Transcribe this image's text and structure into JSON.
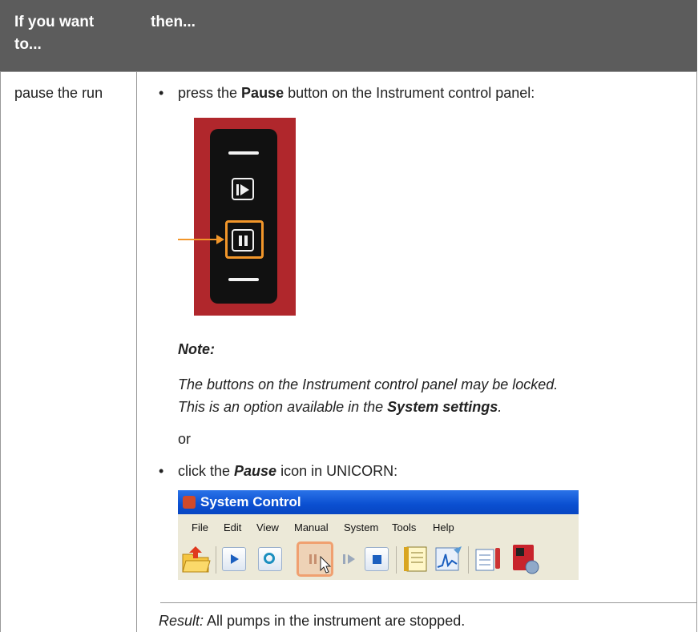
{
  "header": {
    "col1": "If you want to...",
    "col2": "then..."
  },
  "row": {
    "action": "pause the run",
    "step1_pre": "press the ",
    "step1_bold": "Pause",
    "step1_post": " button on the Instrument control panel:",
    "note_title": "Note:",
    "note_line1": "The buttons on the Instrument control panel may be locked.",
    "note_line2_pre": "This is an option available in the ",
    "note_line2_bold": "System settings",
    "note_line2_post": ".",
    "or": "or",
    "step2_pre": "click the ",
    "step2_bold": "Pause",
    "step2_post": " icon in UNICORN:",
    "result_label": "Result:",
    "result_text": " All pumps in the instrument are stopped.",
    "bullet": "•"
  },
  "unicorn": {
    "title": "System Control",
    "menu": [
      "File",
      "Edit",
      "View",
      "Manual",
      "System",
      "Tools",
      "Help"
    ],
    "toolbar_icons": [
      "open-folder-icon",
      "run-icon",
      "rerun-icon",
      "pause-icon",
      "continue-icon",
      "stop-icon",
      "logbook-icon",
      "curve-icon",
      "settings-list-icon",
      "instrument-icon"
    ]
  },
  "colors": {
    "header_bg": "#5c5c5c",
    "panel_red": "#b0272c",
    "highlight_orange": "#f2962a",
    "xp_blue": "#0a4fd1"
  }
}
